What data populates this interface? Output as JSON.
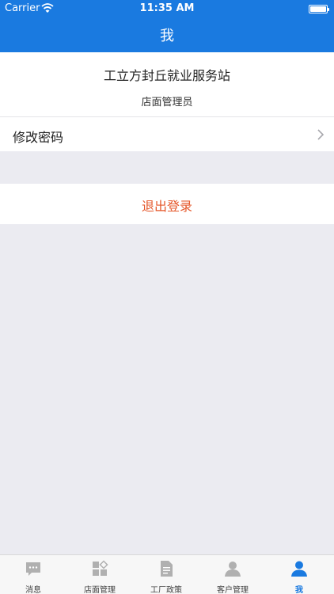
{
  "status": {
    "carrier": "Carrier",
    "time": "11:35 AM"
  },
  "nav": {
    "title": "我"
  },
  "profile": {
    "name": "工立方封丘就业服务站",
    "role": "店面管理员"
  },
  "menu": {
    "change_password": "修改密码"
  },
  "logout": {
    "label": "退出登录"
  },
  "tabs": [
    {
      "label": "消息",
      "icon": "message-icon"
    },
    {
      "label": "店面管理",
      "icon": "store-icon"
    },
    {
      "label": "工厂政策",
      "icon": "document-icon"
    },
    {
      "label": "客户管理",
      "icon": "customers-icon"
    },
    {
      "label": "我",
      "icon": "person-icon",
      "active": true
    }
  ],
  "colors": {
    "brand": "#1a7ae0",
    "logout": "#e5572a",
    "background": "#ebebf1"
  }
}
